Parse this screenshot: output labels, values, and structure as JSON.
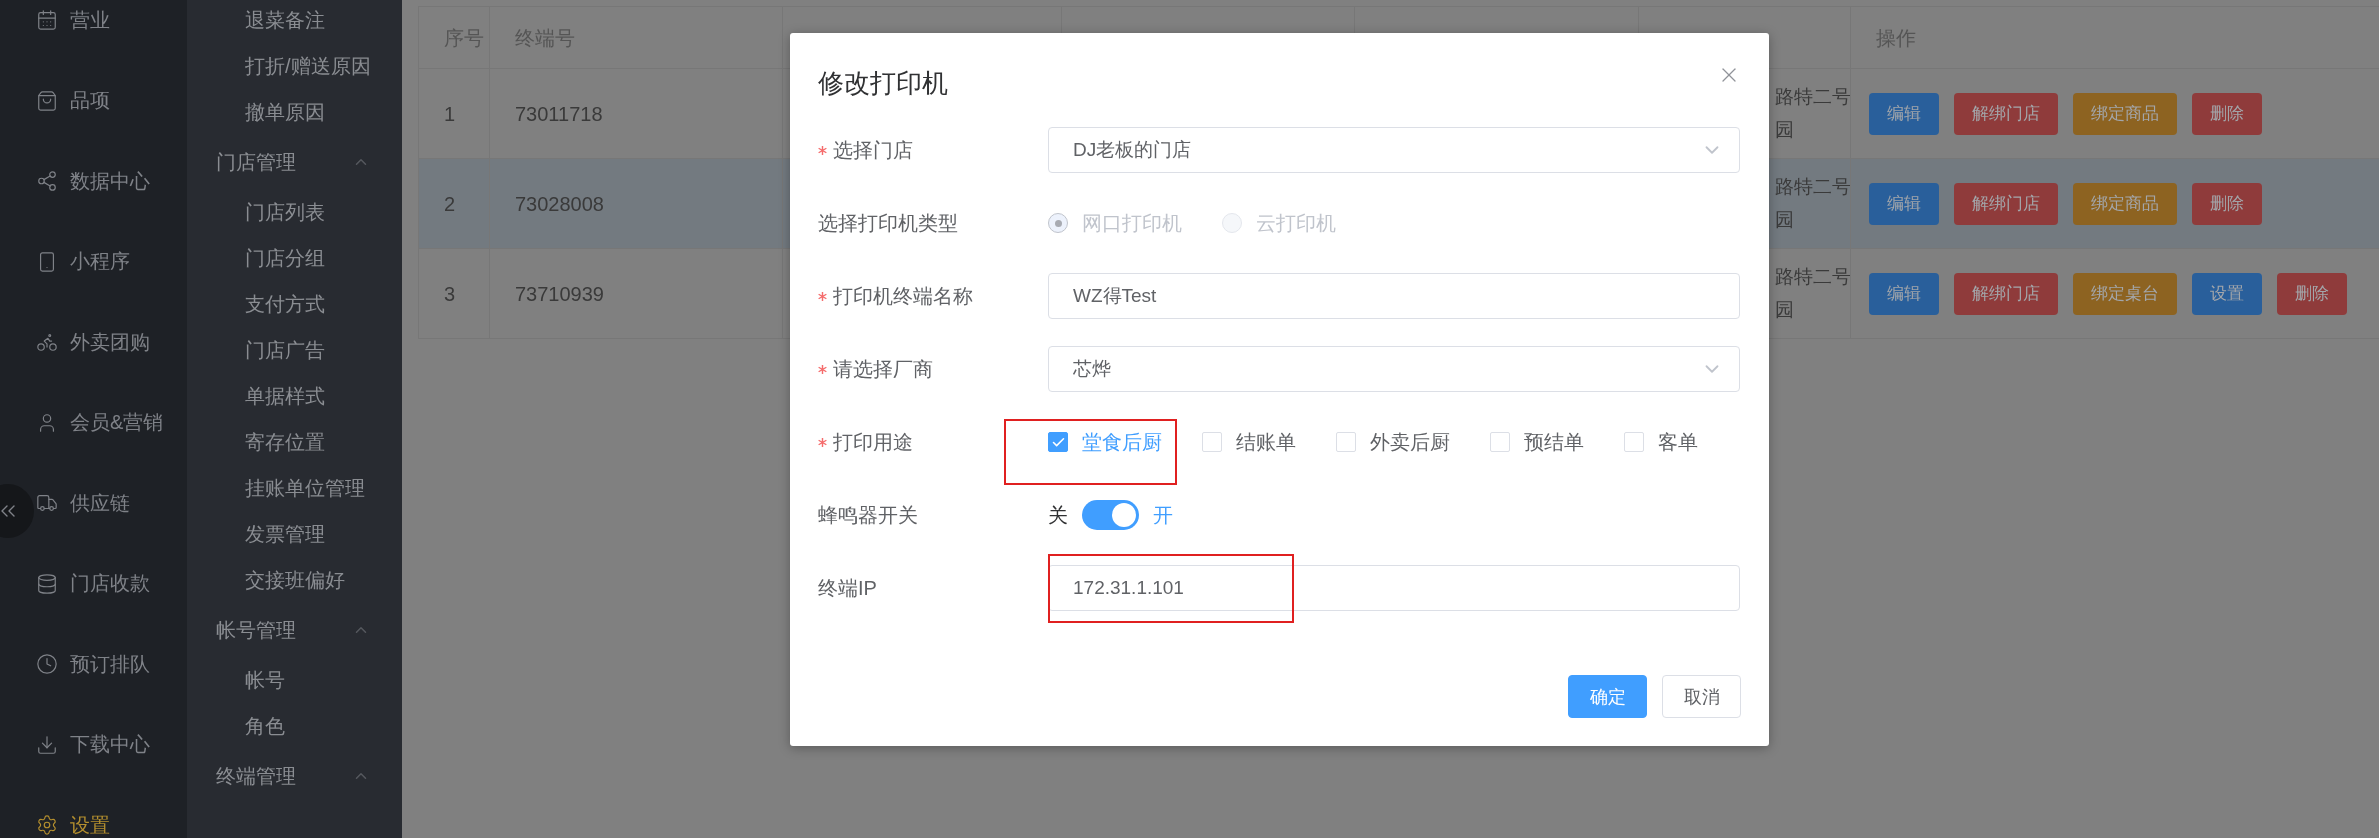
{
  "nav": [
    {
      "label": "营业",
      "selected": false
    },
    {
      "label": "品项",
      "selected": false
    },
    {
      "label": "数据中心",
      "selected": false
    },
    {
      "label": "小程序",
      "selected": false
    },
    {
      "label": "外卖团购",
      "selected": false
    },
    {
      "label": "会员&营销",
      "selected": false
    },
    {
      "label": "供应链",
      "selected": false
    },
    {
      "label": "门店收款",
      "selected": false
    },
    {
      "label": "预订排队",
      "selected": false
    },
    {
      "label": "下载中心",
      "selected": false
    },
    {
      "label": "设置",
      "selected": true
    }
  ],
  "subnav": [
    {
      "kind": "item",
      "label": "退菜备注"
    },
    {
      "kind": "item",
      "label": "打折/赠送原因"
    },
    {
      "kind": "item",
      "label": "撤单原因"
    },
    {
      "kind": "group",
      "label": "门店管理",
      "expanded": true,
      "children": [
        {
          "label": "门店列表"
        },
        {
          "label": "门店分组"
        },
        {
          "label": "支付方式"
        },
        {
          "label": "门店广告"
        },
        {
          "label": "单据样式"
        },
        {
          "label": "寄存位置"
        },
        {
          "label": "挂账单位管理"
        },
        {
          "label": "发票管理"
        },
        {
          "label": "交接班偏好"
        }
      ]
    },
    {
      "kind": "group",
      "label": "帐号管理",
      "expanded": true,
      "children": [
        {
          "label": "帐号"
        },
        {
          "label": "角色"
        }
      ]
    },
    {
      "kind": "group",
      "label": "终端管理",
      "expanded": true
    }
  ],
  "table": {
    "columns": [
      "序号",
      "终端号",
      "操作"
    ],
    "rows": [
      {
        "index": "1",
        "terminal": "73011718",
        "address": [
          "路特二号",
          "园"
        ],
        "selected": false,
        "actions": [
          {
            "label": "编辑",
            "kind": "primary"
          },
          {
            "label": "解绑门店",
            "kind": "danger"
          },
          {
            "label": "绑定商品",
            "kind": "warning"
          },
          {
            "label": "删除",
            "kind": "danger"
          }
        ]
      },
      {
        "index": "2",
        "terminal": "73028008",
        "address": [
          "路特二号",
          "园"
        ],
        "selected": true,
        "actions": [
          {
            "label": "编辑",
            "kind": "primary"
          },
          {
            "label": "解绑门店",
            "kind": "danger"
          },
          {
            "label": "绑定商品",
            "kind": "warning"
          },
          {
            "label": "删除",
            "kind": "danger"
          }
        ]
      },
      {
        "index": "3",
        "terminal": "73710939",
        "address": [
          "路特二号",
          "园"
        ],
        "selected": false,
        "actions": [
          {
            "label": "编辑",
            "kind": "primary"
          },
          {
            "label": "解绑门店",
            "kind": "danger"
          },
          {
            "label": "绑定桌台",
            "kind": "warning"
          },
          {
            "label": "设置",
            "kind": "primary"
          },
          {
            "label": "删除",
            "kind": "danger"
          }
        ]
      }
    ]
  },
  "dialog": {
    "title": "修改打印机",
    "fields": [
      {
        "kind": "select",
        "label": "选择门店",
        "required": true,
        "annotated": false,
        "value": "DJ老板的门店"
      },
      {
        "kind": "radio",
        "label": "选择打印机类型",
        "required": false,
        "annotated": false,
        "disabled": true,
        "options": [
          {
            "label": "网口打印机",
            "selected": true
          },
          {
            "label": "云打印机",
            "selected": false
          }
        ]
      },
      {
        "kind": "input",
        "label": "打印机终端名称",
        "required": true,
        "annotated": false,
        "value": "WZ得Test"
      },
      {
        "kind": "select",
        "label": "请选择厂商",
        "required": true,
        "annotated": false,
        "value": "芯烨"
      },
      {
        "kind": "checkbox",
        "label": "打印用途",
        "required": true,
        "annotated": true,
        "options": [
          {
            "label": "堂食后厨",
            "checked": true
          },
          {
            "label": "结账单",
            "checked": false
          },
          {
            "label": "外卖后厨",
            "checked": false
          },
          {
            "label": "预结单",
            "checked": false
          },
          {
            "label": "客单",
            "checked": false
          }
        ]
      },
      {
        "kind": "switch",
        "label": "蜂鸣器开关",
        "required": false,
        "annotated": false,
        "off_label": "关",
        "on_label": "开",
        "on": true
      },
      {
        "kind": "input",
        "label": "终端IP",
        "required": false,
        "annotated": true,
        "value": "172.31.1.101"
      }
    ],
    "buttons": [
      {
        "label": "确定",
        "kind": "primary"
      },
      {
        "label": "取消",
        "kind": "default"
      }
    ]
  }
}
